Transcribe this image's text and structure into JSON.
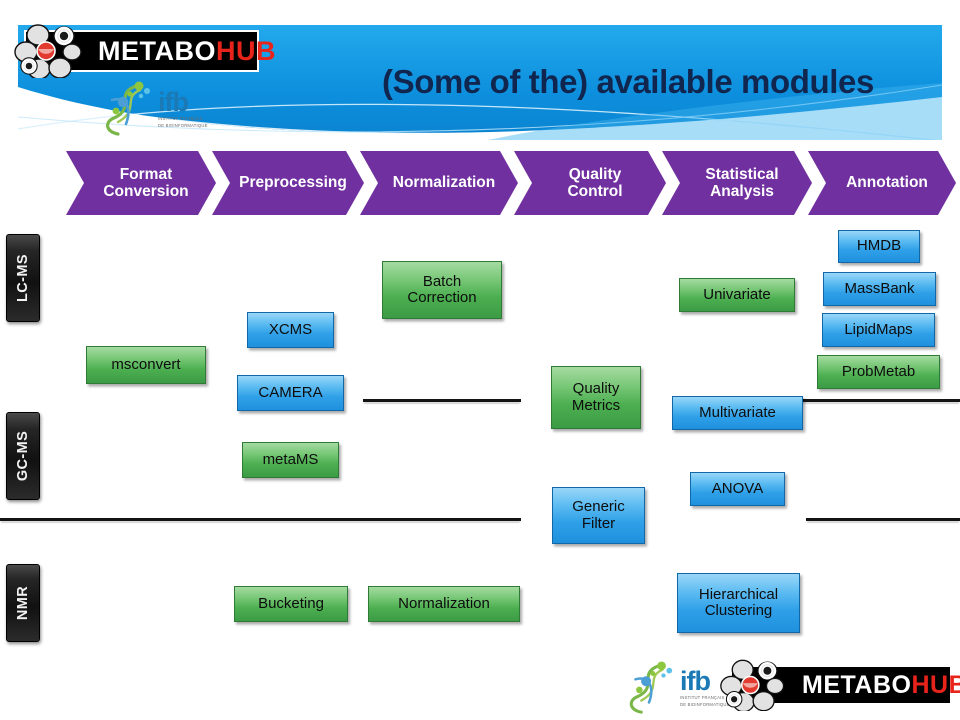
{
  "header": {
    "title": "(Some of the) available modules",
    "brand_metabohub": {
      "part1": "METABO",
      "part2": "HUB"
    },
    "brand_ifb": {
      "acronym": "ifb",
      "line1": "INSTITUT FRANÇAIS",
      "line2": "DE BIOINFORMATIQUE"
    },
    "banner_color": "#0d8fdd",
    "title_color": "#10264f"
  },
  "footer": {
    "brand_metabohub": {
      "part1": "METABO",
      "part2": "HUB"
    },
    "brand_ifb": {
      "acronym": "ifb",
      "line1": "INSTITUT FRANÇAIS",
      "line2": "DE BIOINFORMATIQUE"
    }
  },
  "pipeline": {
    "accent_color": "#7030a0",
    "steps": [
      {
        "label": "Format\nConversion",
        "line1": "Format",
        "line2": "Conversion"
      },
      {
        "label": "Preprocessing",
        "line1": "Preprocessing",
        "line2": ""
      },
      {
        "label": "Normalization",
        "line1": "Normalization",
        "line2": ""
      },
      {
        "label": "Quality\nControl",
        "line1": "Quality",
        "line2": "Control"
      },
      {
        "label": "Statistical\nAnalysis",
        "line1": "Statistical",
        "line2": "Analysis"
      },
      {
        "label": "Annotation",
        "line1": "Annotation",
        "line2": ""
      }
    ]
  },
  "techniques": [
    {
      "label": "LC-MS"
    },
    {
      "label": "GC-MS"
    },
    {
      "label": "NMR"
    }
  ],
  "modules": [
    {
      "label": "msconvert",
      "line1": "msconvert",
      "line2": "",
      "color": "green"
    },
    {
      "label": "XCMS",
      "line1": "XCMS",
      "line2": "",
      "color": "blue"
    },
    {
      "label": "CAMERA",
      "line1": "CAMERA",
      "line2": "",
      "color": "blue"
    },
    {
      "label": "metaMS",
      "line1": "metaMS",
      "line2": "",
      "color": "green"
    },
    {
      "label": "Batch Correction",
      "line1": "Batch",
      "line2": "Correction",
      "color": "green"
    },
    {
      "label": "Quality Metrics",
      "line1": "Quality",
      "line2": "Metrics",
      "color": "green"
    },
    {
      "label": "Generic Filter",
      "line1": "Generic",
      "line2": "Filter",
      "color": "blue"
    },
    {
      "label": "Univariate",
      "line1": "Univariate",
      "line2": "",
      "color": "green"
    },
    {
      "label": "Multivariate",
      "line1": "Multivariate",
      "line2": "",
      "color": "blue"
    },
    {
      "label": "ANOVA",
      "line1": "ANOVA",
      "line2": "",
      "color": "blue"
    },
    {
      "label": "HMDB",
      "line1": "HMDB",
      "line2": "",
      "color": "blue"
    },
    {
      "label": "MassBank",
      "line1": "MassBank",
      "line2": "",
      "color": "blue"
    },
    {
      "label": "LipidMaps",
      "line1": "LipidMaps",
      "line2": "",
      "color": "blue"
    },
    {
      "label": "ProbMetab",
      "line1": "ProbMetab",
      "line2": "",
      "color": "green"
    },
    {
      "label": "Bucketing",
      "line1": "Bucketing",
      "line2": "",
      "color": "green"
    },
    {
      "label": "Normalization",
      "line1": "Normalization",
      "line2": "",
      "color": "green"
    },
    {
      "label": "Hierarchical Clustering",
      "line1": "Hierarchical",
      "line2": "Clustering",
      "color": "blue"
    }
  ],
  "colors": {
    "green_box": "#4caf50",
    "blue_box": "#2fa0e8",
    "chevron_purple": "#7030a0",
    "divider": "#141414",
    "tab_black": "#111111"
  }
}
